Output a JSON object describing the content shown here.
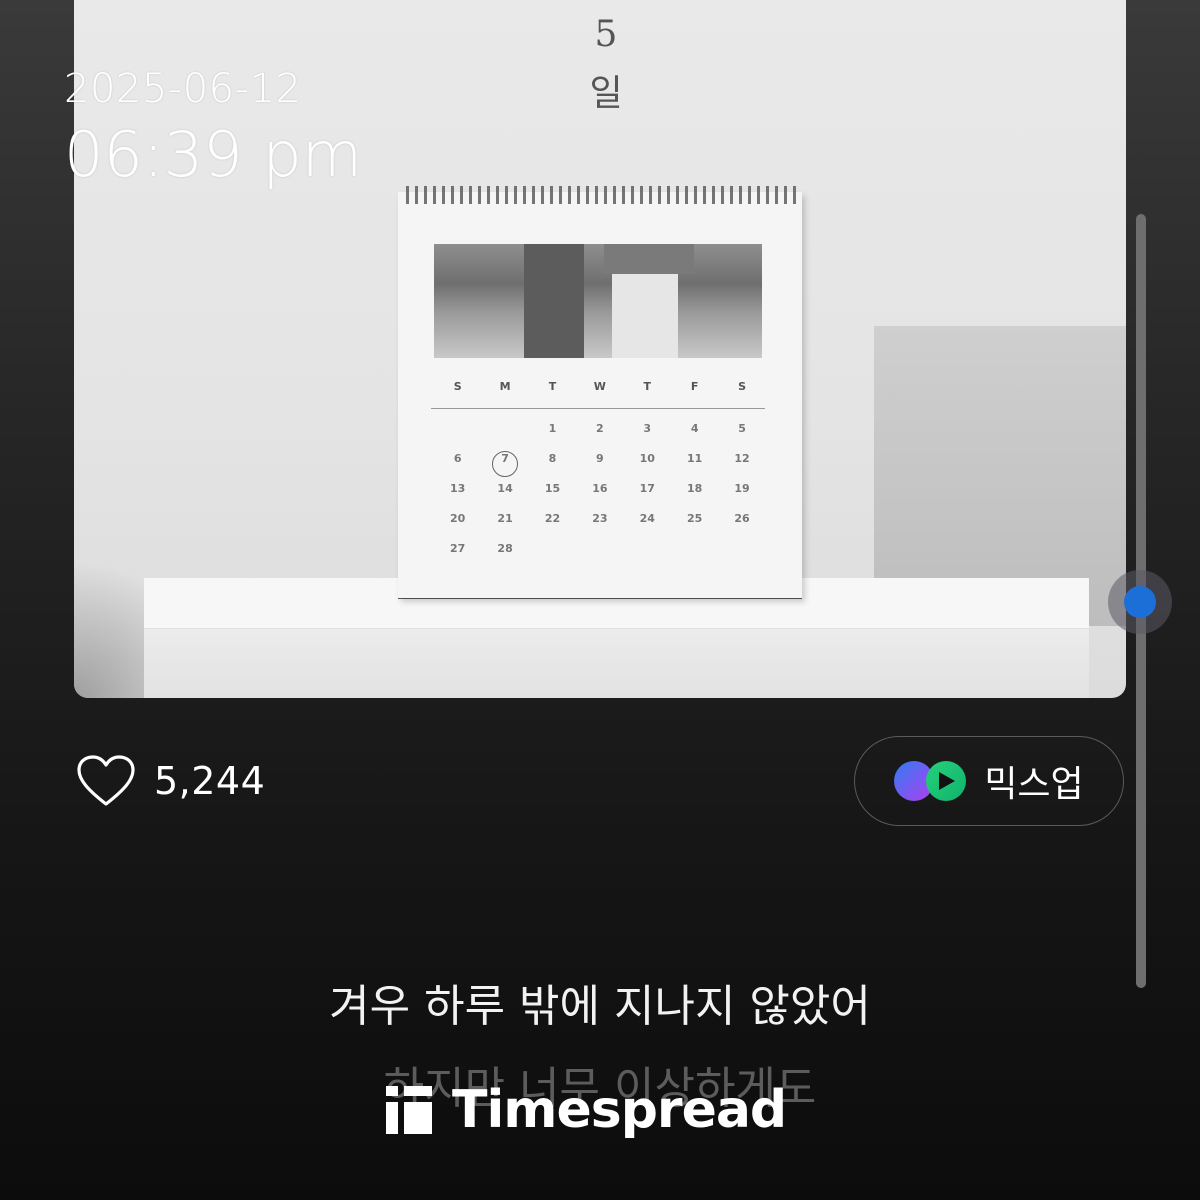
{
  "overlay": {
    "date": "2025-06-12",
    "time": "06:39 pm"
  },
  "album_art": {
    "text_top_number": "5",
    "text_top_char": "일",
    "calendar": {
      "weekdays": [
        "S",
        "M",
        "T",
        "W",
        "T",
        "F",
        "S"
      ],
      "rows": [
        [
          "",
          "",
          "1",
          "2",
          "3",
          "4",
          "5"
        ],
        [
          "6",
          "7",
          "8",
          "9",
          "10",
          "11",
          "12"
        ],
        [
          "13",
          "14",
          "15",
          "16",
          "17",
          "18",
          "19"
        ],
        [
          "20",
          "21",
          "22",
          "23",
          "24",
          "25",
          "26"
        ],
        [
          "27",
          "28",
          "",
          "",
          "",
          "",
          ""
        ]
      ],
      "circled_day": "7"
    }
  },
  "actions": {
    "like_count": "5,244",
    "mixup_label": "믹스업"
  },
  "lyrics": {
    "current": "겨우 하루 밖에 지나지 않았어",
    "next": "하지만 너무 이상하게도"
  },
  "watermark": {
    "text": "Timespread"
  },
  "colors": {
    "accent": "#1c6fd6",
    "background": "#161616"
  }
}
